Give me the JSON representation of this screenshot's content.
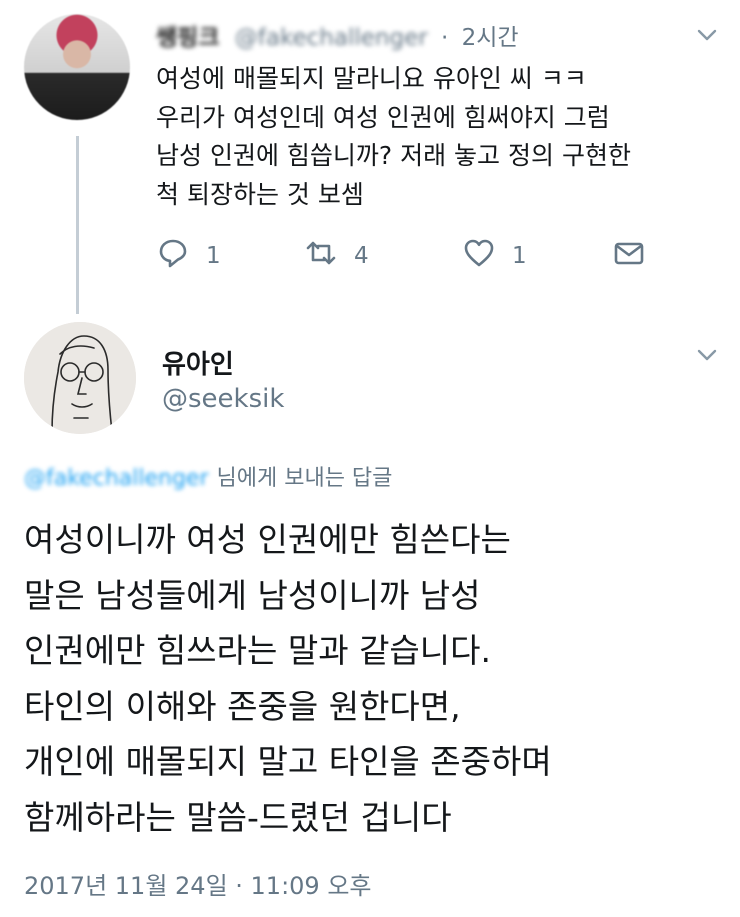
{
  "first_tweet": {
    "author_name": "쌩핑크",
    "author_handle": "@fakechallenger",
    "separator": "·",
    "time_ago": "2시간",
    "text_lines": [
      "여성에 매몰되지 말라니요 유아인 씨 ㅋㅋ",
      "우리가 여성인데 여성 인권에 힘써야지 그럼",
      "남성 인권에 힘씁니까? 저래 놓고 정의 구현한",
      "척 퇴장하는 것 보셈"
    ],
    "actions": {
      "reply_count": "1",
      "retweet_count": "4",
      "like_count": "1"
    },
    "icons": [
      "reply-icon",
      "retweet-icon",
      "like-icon",
      "message-icon",
      "chevron-down-icon"
    ]
  },
  "second_tweet": {
    "author_name": "유아인",
    "author_handle": "@seeksik",
    "reply_to_handle": "@fakechallenger",
    "reply_to_suffix": "님에게 보내는 답글",
    "text_lines": [
      "여성이니까 여성 인권에만 힘쓴다는",
      "말은 남성들에게 남성이니까 남성",
      "인권에만 힘쓰라는 말과 같습니다.",
      "타인의 이해와 존중을 원한다면,",
      "개인에 매몰되지 말고 타인을 존중하며",
      "함께하라는 말씀-드렸던 겁니다"
    ],
    "timestamp": "2017년 11월 24일 · 11:09 오후"
  },
  "colors": {
    "text": "#14171a",
    "secondary": "#657786",
    "link": "#1da1f2",
    "thread_line": "#c4cdd5"
  }
}
